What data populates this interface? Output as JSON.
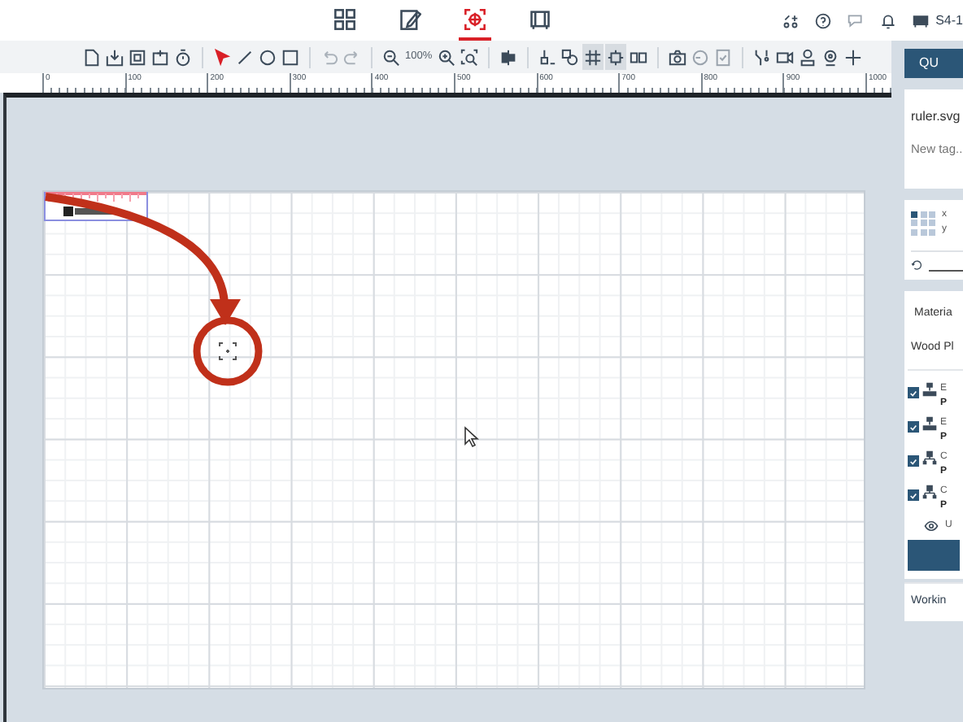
{
  "mode_tabs": [
    {
      "selected": false
    },
    {
      "selected": false
    },
    {
      "selected": true
    },
    {
      "selected": false
    }
  ],
  "device": {
    "name": "S4-1"
  },
  "toolbar": {
    "zoom": "100%",
    "toggles": [
      {
        "on": true
      },
      {
        "on": true
      }
    ]
  },
  "ruler": {
    "labels": [
      "0",
      "100",
      "200",
      "300",
      "400",
      "500",
      "600",
      "700",
      "800",
      "900",
      "1000"
    ]
  },
  "panel": {
    "process_button": "QU",
    "file": {
      "name": "ruler.svg",
      "tag_placeholder": "New tag..."
    },
    "anchors": [
      {
        "selected": true
      },
      {
        "selected": false
      },
      {
        "selected": false
      },
      {
        "selected": false
      },
      {
        "selected": false
      },
      {
        "selected": false
      },
      {
        "selected": false
      },
      {
        "selected": false
      },
      {
        "selected": false
      }
    ],
    "position": {
      "x": "x",
      "y": "y"
    },
    "material": {
      "header": "Materia",
      "value": "Wood Pl"
    },
    "layers": [
      {
        "kind": "engrave",
        "checked": true,
        "title": "E",
        "param": "P"
      },
      {
        "kind": "engrave",
        "checked": true,
        "title": "E",
        "param": "P"
      },
      {
        "kind": "cut",
        "checked": true,
        "title": "C",
        "param": "P"
      },
      {
        "kind": "cut",
        "checked": true,
        "title": "C",
        "param": "P"
      }
    ],
    "output": {
      "label": "U"
    },
    "working_tab": "Workin"
  }
}
